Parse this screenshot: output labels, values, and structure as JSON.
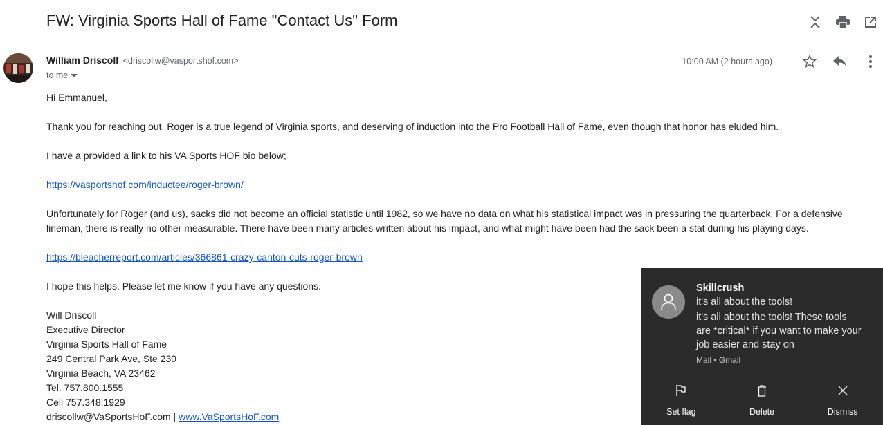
{
  "email": {
    "subject": "FW: Virginia Sports Hall of Fame \"Contact Us\" Form",
    "sender_name": "William Driscoll",
    "sender_email": "<driscollw@vasportshof.com>",
    "to": "to me",
    "time": "10:00 AM (2 hours ago)",
    "body": {
      "greeting": "Hi Emmanuel,",
      "p1": "Thank you for reaching out. Roger is a true legend of Virginia sports, and deserving of induction into the Pro Football Hall of Fame, even though that honor has eluded him.",
      "p2": "I have a provided a link to his VA Sports HOF bio below;",
      "link1": "https://vasportshof.com/inductee/roger-brown/",
      "p3": "Unfortunately for Roger (and us), sacks did not become an official statistic until 1982, so we have no data on what his statistical impact was in pressuring the quarterback. For a defensive lineman, there is really no other measurable.  There have been many articles written about his impact, and what might have been had the sack been a stat during his playing days.",
      "link2": "https://bleacherreport.com/articles/366861-crazy-canton-cuts-roger-brown",
      "p4": "I hope this helps.  Please let me know if you have any questions."
    },
    "signature": {
      "name": "Will Driscoll",
      "title": "Executive Director",
      "org": "Virginia Sports Hall of Fame",
      "address1": "249 Central Park Ave, Ste 230",
      "address2": "Virginia Beach, VA 23462",
      "tel": "Tel. 757.800.1555",
      "cell": "Cell 757.348.1929",
      "email_prefix": "driscollw@VaSportsHoF.com | ",
      "website": "www.VaSportsHoF.com"
    }
  },
  "icons": {
    "collapse": "collapse-icon",
    "print": "print-icon",
    "open_new": "open-in-new-window-icon",
    "star": "star-icon",
    "reply": "reply-icon",
    "more": "more-vertical-icon",
    "dropdown": "caret-down-icon",
    "person": "person-icon",
    "flag": "flag-icon",
    "trash": "trash-icon",
    "close": "close-icon"
  },
  "notification": {
    "title": "Skillcrush",
    "line1": "it's all about the tools!",
    "line2": "it's all about the tools! These tools are *critical* if you want to make your job easier and stay on",
    "source": "Mail • Gmail",
    "actions": {
      "set_flag": "Set flag",
      "delete": "Delete",
      "dismiss": "Dismiss"
    }
  },
  "colors": {
    "link": "#1155cc",
    "toast_bg": "#2b2b2b"
  }
}
